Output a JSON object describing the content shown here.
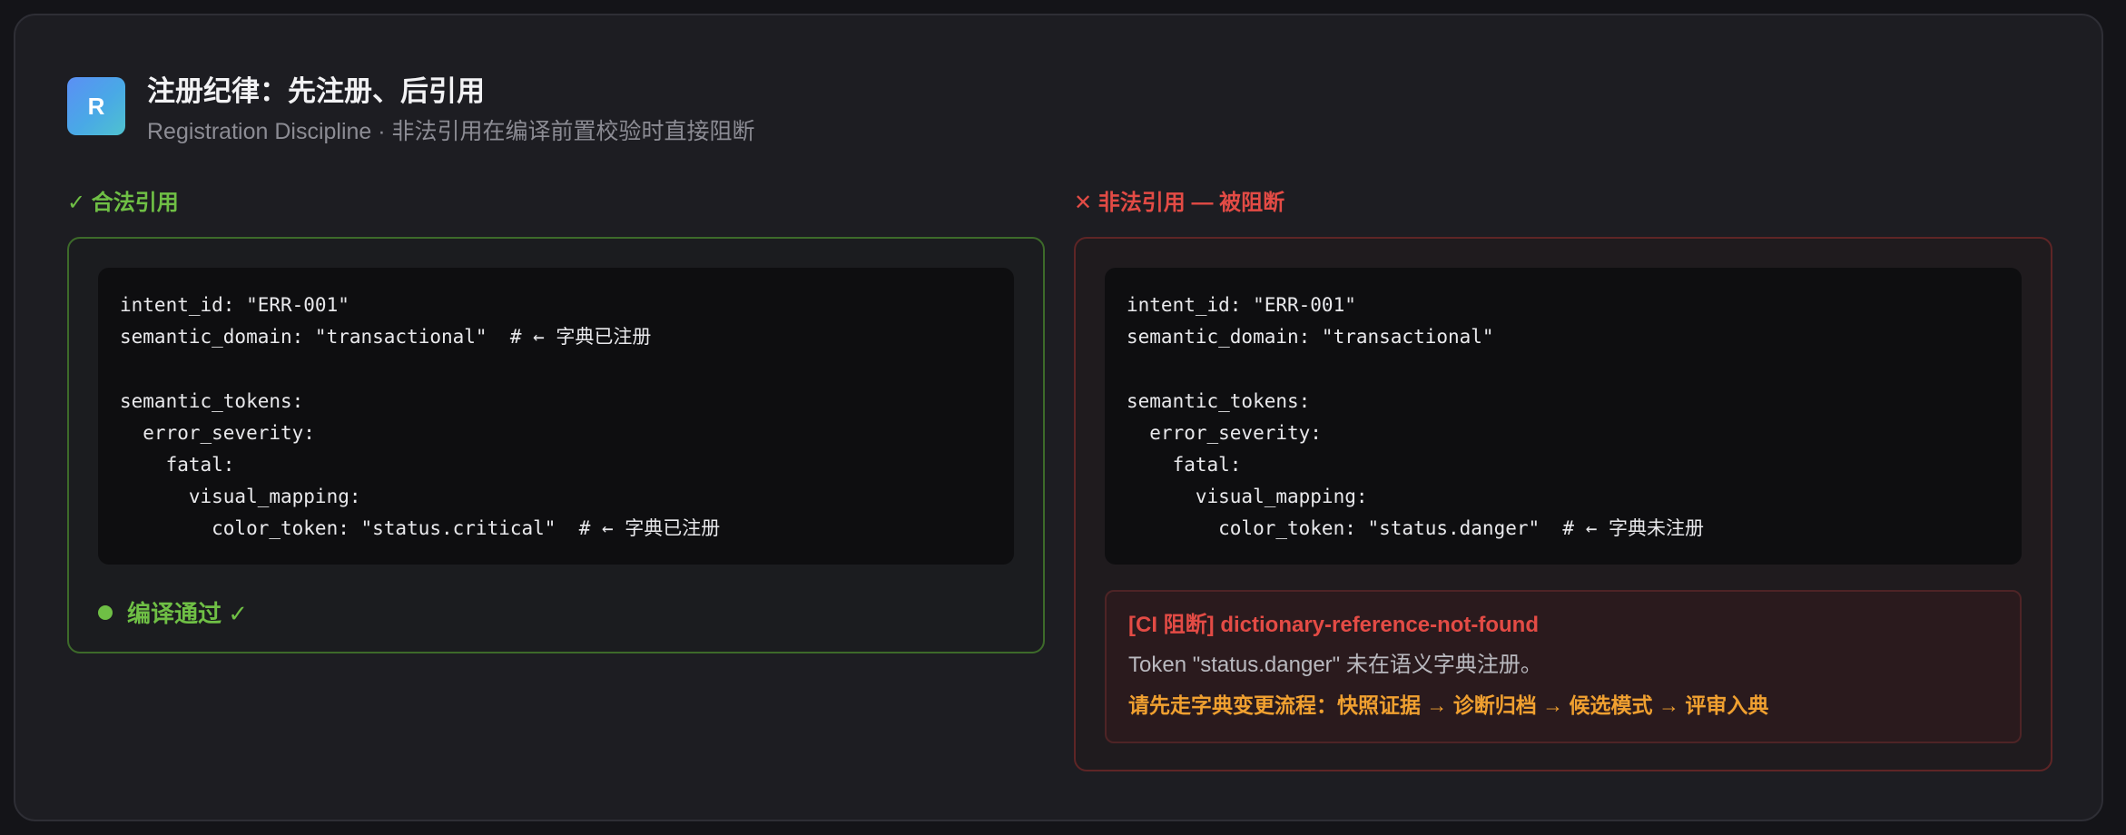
{
  "header": {
    "logo_letter": "R",
    "title": "注册纪律：先注册、后引用",
    "subtitle": "Registration Discipline · 非法引用在编译前置校验时直接阻断"
  },
  "valid": {
    "label": "✓ 合法引用",
    "code_lines": [
      "intent_id: \"ERR-001\"",
      "semantic_domain: \"transactional\"  # ← 字典已注册",
      "",
      "semantic_tokens:",
      "  error_severity:",
      "    fatal:",
      "      visual_mapping:",
      "        color_token: \"status.critical\"  # ← 字典已注册"
    ],
    "status_text": "编译通过 ✓"
  },
  "invalid": {
    "label": "✕ 非法引用 — 被阻断",
    "code_lines": [
      "intent_id: \"ERR-001\"",
      "semantic_domain: \"transactional\"",
      "",
      "semantic_tokens:",
      "  error_severity:",
      "    fatal:",
      "      visual_mapping:",
      "        color_token: \"status.danger\"  # ← 字典未注册"
    ],
    "alert": {
      "title": "[CI 阻断] dictionary-reference-not-found",
      "message": "Token \"status.danger\" 未在语义字典注册。",
      "hint": "请先走字典变更流程：快照证据 → 诊断归档 → 候选模式 → 评审入典"
    }
  },
  "colors": {
    "success": "#6fbf45",
    "danger": "#e34b45",
    "warning": "#f0a030",
    "logo_gradient_start": "#5b8ff5",
    "logo_gradient_end": "#4fc2cf"
  }
}
